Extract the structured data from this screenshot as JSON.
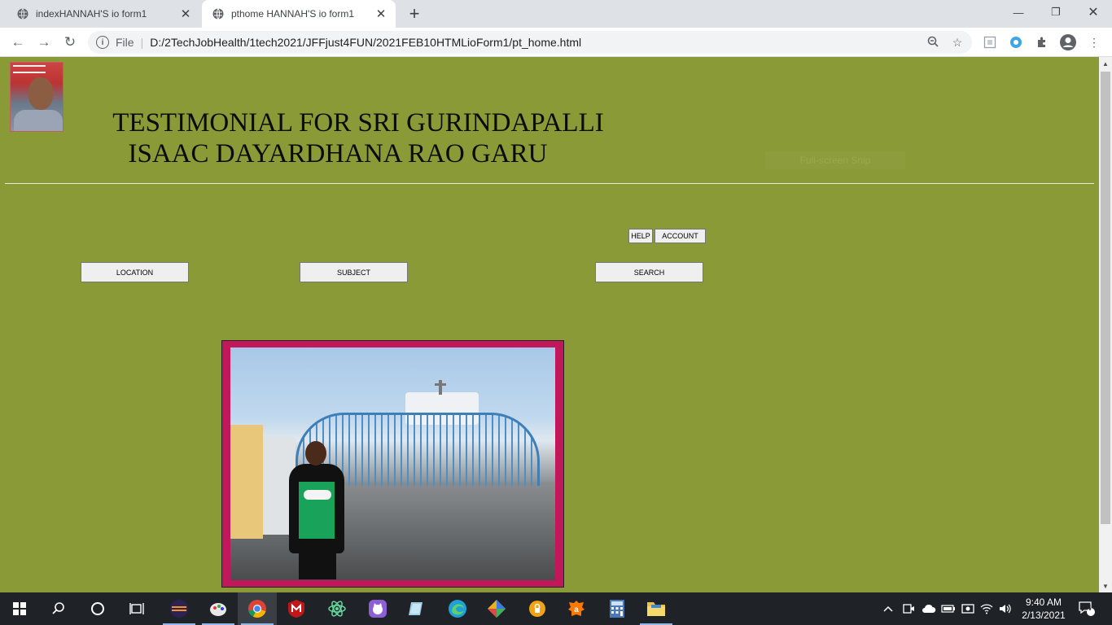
{
  "browser": {
    "tabs": [
      {
        "title": "indexHANNAH'S io form1",
        "active": false
      },
      {
        "title": "pthome HANNAH'S io form1",
        "active": true
      }
    ],
    "address": {
      "scheme_label": "File",
      "url": "D:/2TechJobHealth/1tech2021/JFFjust4FUN/2021FEB10HTMLioForm1/pt_home.html"
    }
  },
  "page": {
    "title_line1": "TESTIMONIAL FOR SRI GURINDAPALLI",
    "title_line2": "ISAAC DAYARDHANA RAO GARU",
    "fullscreen_label": "Full-screen Snip",
    "buttons": {
      "help": "HELP",
      "account": "ACCOUNT",
      "location": "LOCATION",
      "subject": "SUBJECT",
      "search": "SEARCH"
    },
    "colors": {
      "background": "#8a9a36",
      "photo_frame": "#c2185b"
    }
  },
  "taskbar": {
    "time": "9:40 AM",
    "date": "2/13/2021",
    "notification_count": "4"
  }
}
